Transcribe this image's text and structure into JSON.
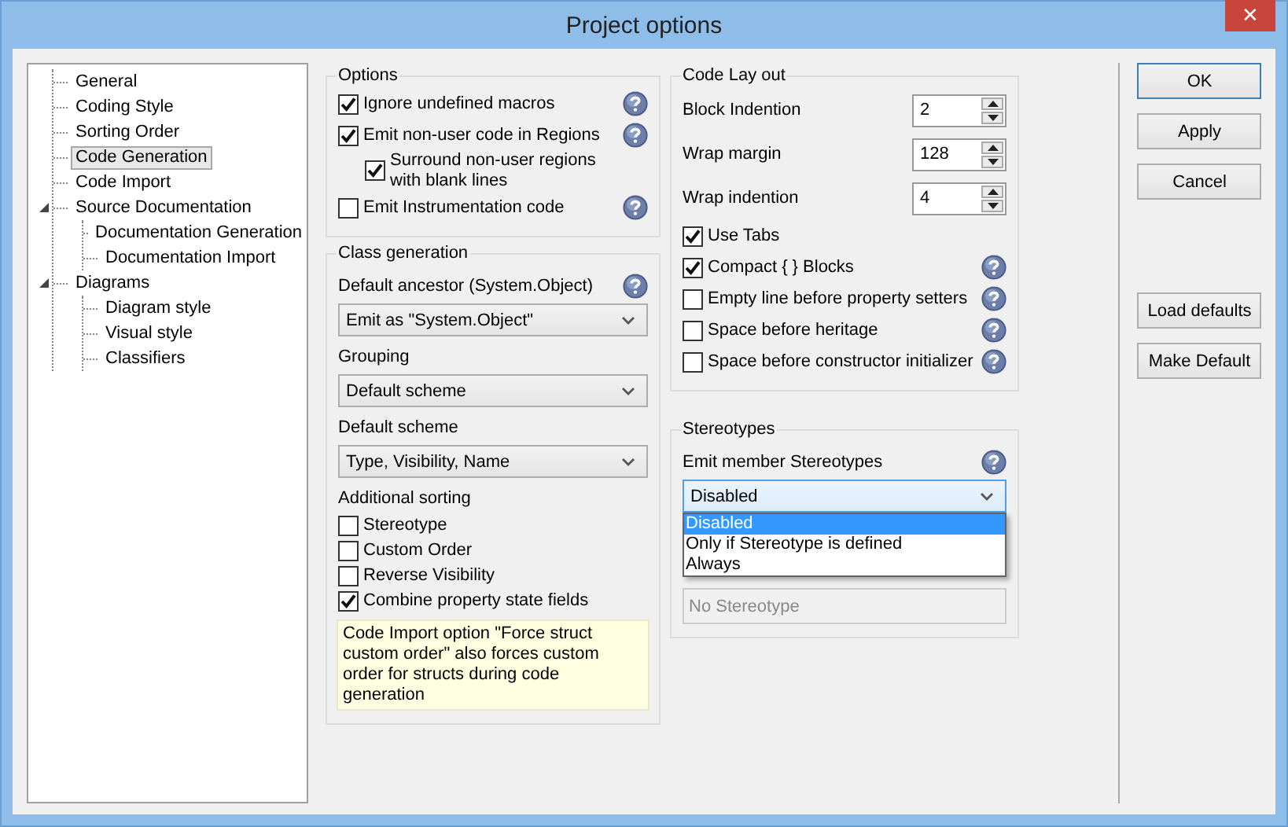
{
  "window": {
    "title": "Project options",
    "close": "✕"
  },
  "tree": [
    {
      "label": "General",
      "selected": false
    },
    {
      "label": "Coding Style",
      "selected": false
    },
    {
      "label": "Sorting Order",
      "selected": false
    },
    {
      "label": "Code Generation",
      "selected": true
    },
    {
      "label": "Code Import",
      "selected": false
    },
    {
      "label": "Source Documentation",
      "selected": false,
      "expanded": true,
      "children": [
        {
          "label": "Documentation Generation",
          "selected": false
        },
        {
          "label": "Documentation Import",
          "selected": false
        }
      ]
    },
    {
      "label": "Diagrams",
      "selected": false,
      "expanded": true,
      "children": [
        {
          "label": "Diagram style",
          "selected": false
        },
        {
          "label": "Visual style",
          "selected": false
        },
        {
          "label": "Classifiers",
          "selected": false
        }
      ]
    }
  ],
  "options": {
    "title": "Options",
    "items": [
      {
        "label": "Ignore undefined macros",
        "checked": true,
        "help": true
      },
      {
        "label": "Emit non-user code in Regions",
        "checked": true,
        "help": true,
        "children": [
          {
            "label": "Surround non-user regions with blank lines",
            "checked": true,
            "help": false
          }
        ]
      },
      {
        "label": "Emit Instrumentation code",
        "checked": false,
        "help": true
      }
    ]
  },
  "class_generation": {
    "title": "Class generation",
    "fields": [
      {
        "label": "Default ancestor (System.Object)",
        "help": true,
        "value": "Emit as \"System.Object\""
      },
      {
        "label": "Grouping",
        "help": false,
        "value": "Default scheme"
      },
      {
        "label": "Default scheme",
        "help": false,
        "value": "Type, Visibility, Name"
      }
    ],
    "sorting_title": "Additional sorting",
    "sorting": [
      {
        "label": "Stereotype",
        "checked": false
      },
      {
        "label": "Custom Order",
        "checked": false
      },
      {
        "label": "Reverse Visibility",
        "checked": false
      },
      {
        "label": "Combine property state fields",
        "checked": true
      }
    ],
    "note": "Code Import option \"Force struct custom order\" also forces custom order for structs during code generation"
  },
  "code_layout": {
    "title": "Code Lay out",
    "spinners": [
      {
        "label": "Block Indention",
        "value": "2"
      },
      {
        "label": "Wrap margin",
        "value": "128"
      },
      {
        "label": "Wrap indention",
        "value": "4"
      }
    ],
    "checks": [
      {
        "label": "Use Tabs",
        "checked": true,
        "help": false
      },
      {
        "label": "Compact { } Blocks",
        "checked": true,
        "help": true
      },
      {
        "label": "Empty line before property setters",
        "checked": false,
        "help": true
      },
      {
        "label": "Space before heritage",
        "checked": false,
        "help": true
      },
      {
        "label": "Space before constructor initializer",
        "checked": false,
        "help": true
      }
    ]
  },
  "stereotypes": {
    "title": "Stereotypes",
    "label": "Emit member Stereotypes",
    "help": true,
    "value": "Disabled",
    "dropdown": [
      {
        "label": "Disabled",
        "selected": true
      },
      {
        "label": "Only if Stereotype is defined",
        "selected": false
      },
      {
        "label": "Always",
        "selected": false
      }
    ],
    "field": {
      "value": "No Stereotype",
      "disabled": true
    }
  },
  "buttons": [
    {
      "label": "OK",
      "focused": true
    },
    {
      "label": "Apply",
      "focused": false
    },
    {
      "label": "Cancel",
      "focused": false
    }
  ],
  "buttons_lower": [
    {
      "label": "Load defaults",
      "focused": false
    },
    {
      "label": "Make Default",
      "focused": false
    }
  ]
}
